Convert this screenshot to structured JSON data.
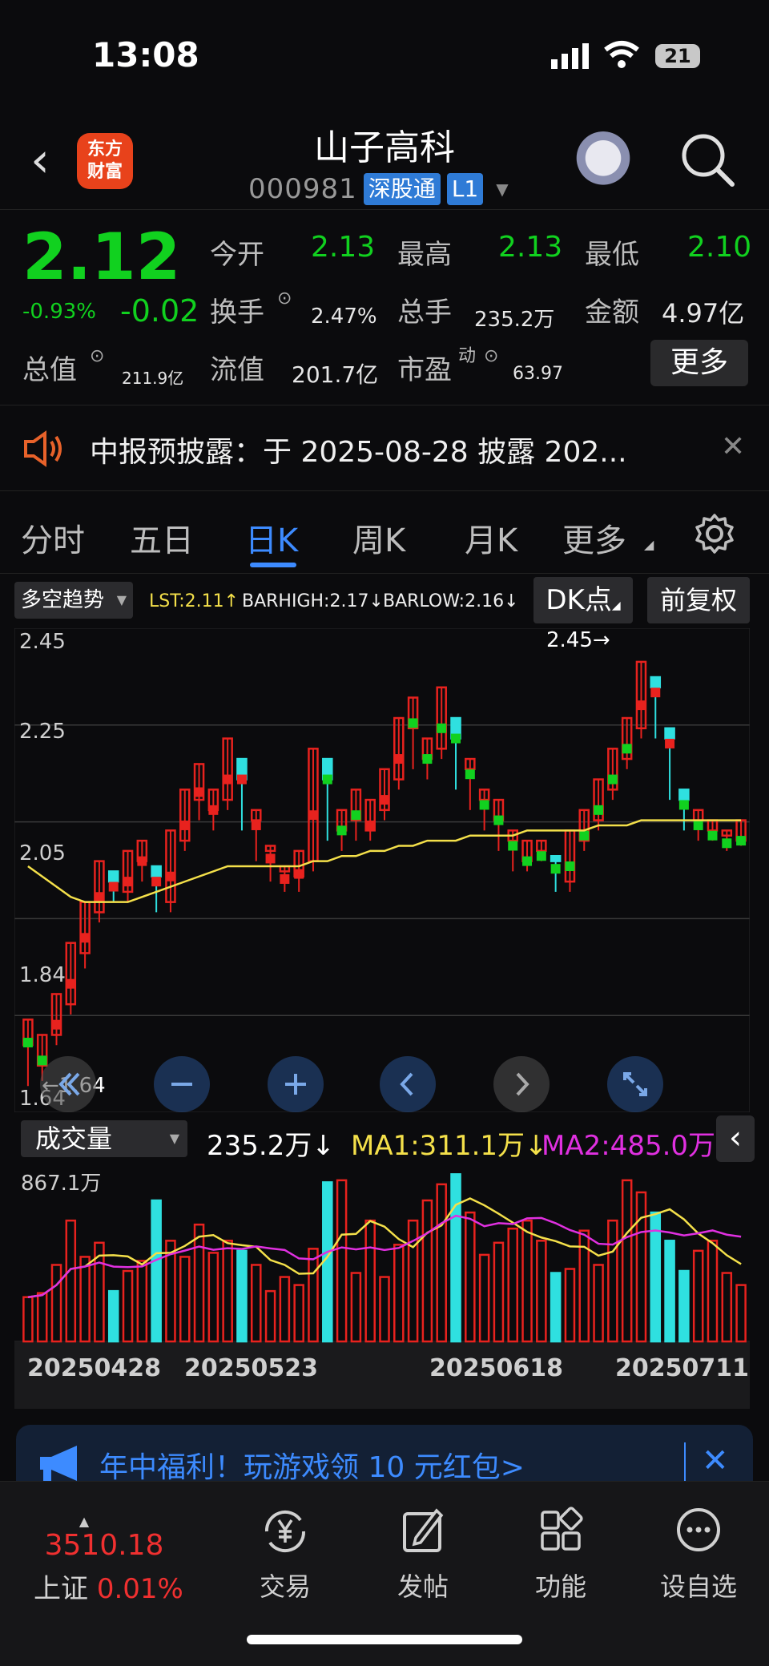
{
  "status": {
    "time": "13:08",
    "battery": "21"
  },
  "header": {
    "title": "山子高科",
    "code": "000981",
    "tag1": "深股通",
    "tag2": "L1",
    "logo_line1": "东方",
    "logo_line2": "财富"
  },
  "quote": {
    "price": "2.12",
    "change_pct": "-0.93%",
    "change": "-0.02",
    "open_label": "今开",
    "open": "2.13",
    "high_label": "最高",
    "high": "2.13",
    "low_label": "最低",
    "low": "2.10",
    "turnover_label": "换手",
    "turnover": "2.47%",
    "volume_label": "总手",
    "volume": "235.2万",
    "amount_label": "金额",
    "amount": "4.97亿",
    "mcap_label": "总值",
    "mcap": "211.9亿",
    "float_label": "流值",
    "float": "201.7亿",
    "pe_label": "市盈",
    "pe_sup": "动",
    "pe": "63.97",
    "more": "更多"
  },
  "notice": {
    "text": "中报预披露：于 2025-08-28 披露 202..."
  },
  "tabs": [
    "分时",
    "五日",
    "日K",
    "周K",
    "月K",
    "更多"
  ],
  "indicator": {
    "select": "多空趋势",
    "lst": "LST:2.11↑",
    "barhigh": "BARHIGH:2.17↓",
    "barlow": "BARLOW:2.16↓",
    "dk": "DK点",
    "fq": "前复权"
  },
  "price_axis": [
    "2.45",
    "2.25",
    "2.05",
    "1.84",
    "1.64"
  ],
  "annotations": {
    "high": "2.45→",
    "low": "←1.64"
  },
  "volume": {
    "select": "成交量",
    "value": "235.2万↓",
    "ma1": "MA1:311.1万↓",
    "ma2": "MA2:485.0万↓",
    "max": "867.1万"
  },
  "dates": [
    "20250428",
    "20250523",
    "20250618",
    "20250711"
  ],
  "banner": {
    "text": "年中福利！玩游戏领 10 元红包>"
  },
  "bottom": {
    "index_value": "3510.18",
    "index_name": "上证",
    "index_change": "0.01%",
    "nav": [
      "交易",
      "发帖",
      "功能",
      "设自选"
    ]
  },
  "colors": {
    "up": "#e8221e",
    "down": "#2fe0e0",
    "green": "#11d11f",
    "accent": "#3d8bff",
    "ma1": "#f4e04a",
    "ma2": "#e030e0"
  },
  "chart_data": {
    "type": "candlestick",
    "ylim": [
      1.6,
      2.5
    ],
    "candles": [
      [
        1.7,
        1.75,
        1.62,
        1.64
      ],
      [
        1.66,
        1.72,
        1.63,
        1.7
      ],
      [
        1.72,
        1.8,
        1.7,
        1.78
      ],
      [
        1.78,
        1.9,
        1.76,
        1.88
      ],
      [
        1.88,
        1.98,
        1.85,
        1.96
      ],
      [
        1.96,
        2.06,
        1.94,
        2.04
      ],
      [
        2.04,
        2.02,
        1.98,
        2.0
      ],
      [
        2.0,
        2.08,
        1.98,
        2.06
      ],
      [
        2.06,
        2.1,
        2.02,
        2.05
      ],
      [
        2.05,
        2.03,
        1.96,
        1.98
      ],
      [
        1.98,
        2.12,
        1.96,
        2.1
      ],
      [
        2.1,
        2.2,
        2.08,
        2.18
      ],
      [
        2.18,
        2.25,
        2.14,
        2.16
      ],
      [
        2.16,
        2.2,
        2.12,
        2.18
      ],
      [
        2.18,
        2.3,
        2.16,
        2.28
      ],
      [
        2.26,
        2.22,
        2.12,
        2.14
      ],
      [
        2.14,
        2.16,
        2.06,
        2.08
      ],
      [
        2.08,
        2.09,
        2.02,
        2.04
      ],
      [
        2.04,
        2.05,
        2.0,
        2.03
      ],
      [
        2.03,
        2.08,
        2.0,
        2.06
      ],
      [
        2.06,
        2.28,
        2.04,
        2.26
      ],
      [
        2.26,
        2.22,
        2.1,
        2.12
      ],
      [
        2.12,
        2.16,
        2.08,
        2.14
      ],
      [
        2.14,
        2.2,
        2.1,
        2.12
      ],
      [
        2.12,
        2.18,
        2.1,
        2.16
      ],
      [
        2.16,
        2.24,
        2.14,
        2.22
      ],
      [
        2.22,
        2.34,
        2.2,
        2.32
      ],
      [
        2.32,
        2.38,
        2.24,
        2.26
      ],
      [
        2.26,
        2.3,
        2.22,
        2.28
      ],
      [
        2.28,
        2.4,
        2.26,
        2.34
      ],
      [
        2.34,
        2.3,
        2.2,
        2.24
      ],
      [
        2.24,
        2.26,
        2.16,
        2.18
      ],
      [
        2.18,
        2.2,
        2.12,
        2.14
      ],
      [
        2.14,
        2.18,
        2.08,
        2.1
      ],
      [
        2.1,
        2.12,
        2.04,
        2.06
      ],
      [
        2.06,
        2.1,
        2.04,
        2.08
      ],
      [
        2.08,
        2.1,
        2.06,
        2.07
      ],
      [
        2.07,
        2.06,
        2.0,
        2.02
      ],
      [
        2.02,
        2.12,
        2.0,
        2.1
      ],
      [
        2.1,
        2.16,
        2.08,
        2.14
      ],
      [
        2.14,
        2.22,
        2.12,
        2.2
      ],
      [
        2.2,
        2.28,
        2.18,
        2.26
      ],
      [
        2.26,
        2.34,
        2.24,
        2.32
      ],
      [
        2.32,
        2.45,
        2.3,
        2.42
      ],
      [
        2.42,
        2.4,
        2.3,
        2.32
      ],
      [
        2.32,
        2.3,
        2.18,
        2.2
      ],
      [
        2.2,
        2.18,
        2.12,
        2.14
      ],
      [
        2.14,
        2.16,
        2.1,
        2.12
      ],
      [
        2.12,
        2.14,
        2.1,
        2.11
      ],
      [
        2.11,
        2.12,
        2.08,
        2.1
      ],
      [
        2.1,
        2.14,
        2.09,
        2.12
      ]
    ],
    "ma_line": [
      2.05,
      2.03,
      2.01,
      1.99,
      1.98,
      1.98,
      1.98,
      1.98,
      1.99,
      2.0,
      2.01,
      2.02,
      2.03,
      2.04,
      2.05,
      2.05,
      2.05,
      2.05,
      2.05,
      2.05,
      2.06,
      2.06,
      2.07,
      2.07,
      2.08,
      2.08,
      2.09,
      2.09,
      2.1,
      2.1,
      2.1,
      2.11,
      2.11,
      2.11,
      2.11,
      2.12,
      2.12,
      2.12,
      2.12,
      2.12,
      2.13,
      2.13,
      2.13,
      2.14,
      2.14,
      2.14,
      2.14,
      2.14,
      2.14,
      2.14,
      2.14
    ],
    "volumes": [
      2.2,
      2.4,
      3.8,
      6.0,
      4.2,
      4.9,
      2.5,
      3.5,
      4.0,
      7.0,
      5.0,
      4.2,
      5.8,
      4.4,
      5.0,
      4.5,
      3.8,
      2.5,
      3.2,
      2.8,
      4.6,
      7.9,
      8.0,
      3.4,
      6.0,
      3.2,
      4.8,
      6.0,
      7.0,
      7.8,
      8.3,
      6.4,
      4.3,
      4.9,
      5.6,
      6.0,
      5.0,
      3.4,
      3.6,
      5.5,
      3.8,
      6.0,
      8.0,
      7.4,
      6.4,
      5.0,
      3.5,
      4.5,
      5.0,
      3.4,
      2.8
    ],
    "vol_max": 8.671
  }
}
